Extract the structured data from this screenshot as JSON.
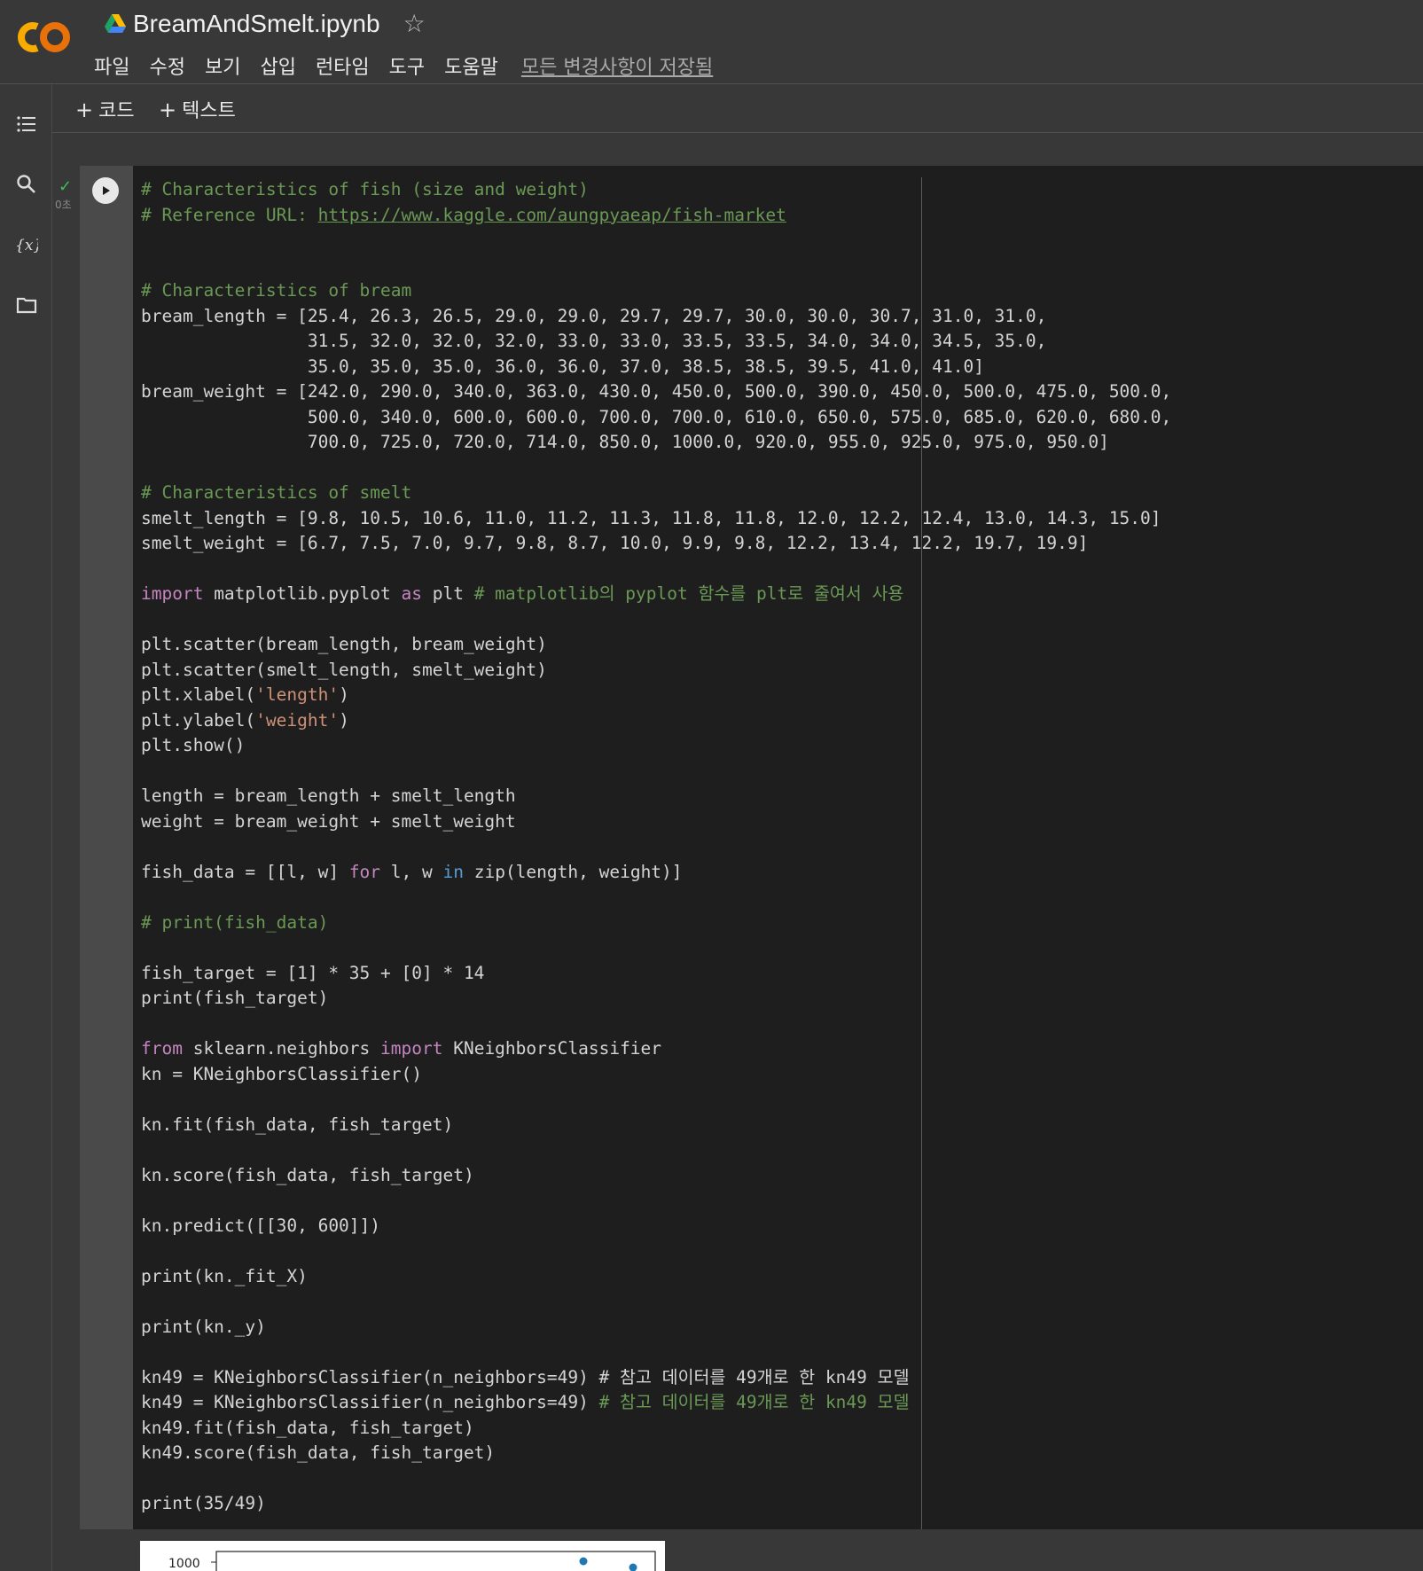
{
  "header": {
    "notebook_title": "BreamAndSmelt.ipynb",
    "menu": [
      "파일",
      "수정",
      "보기",
      "삽입",
      "런타임",
      "도구",
      "도움말"
    ],
    "save_status": "모든 변경사항이 저장됨"
  },
  "toolbar": {
    "add_code_label": "코드",
    "add_text_label": "텍스트"
  },
  "sidebar": {
    "icons": [
      "toc-icon",
      "search-icon",
      "variables-icon",
      "folder-icon"
    ]
  },
  "cell": {
    "run_status": "✓",
    "exec_time": "0초",
    "code_lines": [
      "# Characteristics of fish (size and weight)",
      "# Reference URL: https://www.kaggle.com/aungpyaeap/fish-market",
      "",
      "",
      "# Characteristics of bream",
      "bream_length = [25.4, 26.3, 26.5, 29.0, 29.0, 29.7, 29.7, 30.0, 30.0, 30.7, 31.0, 31.0,",
      "                31.5, 32.0, 32.0, 32.0, 33.0, 33.0, 33.5, 33.5, 34.0, 34.0, 34.5, 35.0,",
      "                35.0, 35.0, 35.0, 36.0, 36.0, 37.0, 38.5, 38.5, 39.5, 41.0, 41.0]",
      "bream_weight = [242.0, 290.0, 340.0, 363.0, 430.0, 450.0, 500.0, 390.0, 450.0, 500.0, 475.0, 500.0,",
      "                500.0, 340.0, 600.0, 600.0, 700.0, 700.0, 610.0, 650.0, 575.0, 685.0, 620.0, 680.0,",
      "                700.0, 725.0, 720.0, 714.0, 850.0, 1000.0, 920.0, 955.0, 925.0, 975.0, 950.0]",
      "",
      "# Characteristics of smelt",
      "smelt_length = [9.8, 10.5, 10.6, 11.0, 11.2, 11.3, 11.8, 11.8, 12.0, 12.2, 12.4, 13.0, 14.3, 15.0]",
      "smelt_weight = [6.7, 7.5, 7.0, 9.7, 9.8, 8.7, 10.0, 9.9, 9.8, 12.2, 13.4, 12.2, 19.7, 19.9]",
      "",
      "import matplotlib.pyplot as plt # matplotlib의 pyplot 함수를 plt로 줄여서 사용",
      "",
      "plt.scatter(bream_length, bream_weight)",
      "plt.scatter(smelt_length, smelt_weight)",
      "plt.xlabel('length')",
      "plt.ylabel('weight')",
      "plt.show()",
      "",
      "length = bream_length + smelt_length",
      "weight = bream_weight + smelt_weight",
      "",
      "fish_data = [[l, w] for l, w in zip(length, weight)]",
      "",
      "# print(fish_data)",
      "",
      "fish_target = [1] * 35 + [0] * 14",
      "print(fish_target)",
      "",
      "from sklearn.neighbors import KNeighborsClassifier",
      "kn = KNeighborsClassifier()",
      "",
      "kn.fit(fish_data, fish_target)",
      "",
      "kn.score(fish_data, fish_target)",
      "",
      "kn.predict([[30, 600]])",
      "",
      "print(kn._fit_X)",
      "",
      "print(kn._y)",
      "",
      "kn49 = KNeighborsClassifier(n_neighbors=49) # 참고 데이터를 49개로 한 kn49 모델",
      "",
      "kn49.fit(fish_data, fish_target)",
      "kn49.score(fish_data, fish_target)",
      "",
      "print(35/49)"
    ]
  },
  "output": {
    "plot_tick_label": "1000"
  }
}
